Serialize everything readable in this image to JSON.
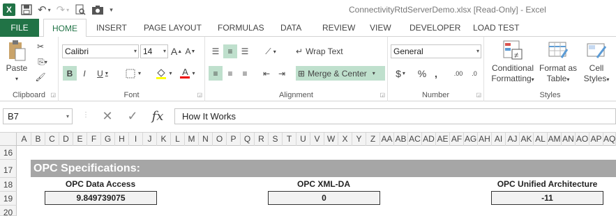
{
  "window": {
    "title": "ConnectivityRtdServerDemo.xlsx  [Read-Only] - Excel",
    "app_logo": "X"
  },
  "tabs": [
    "FILE",
    "HOME",
    "INSERT",
    "PAGE LAYOUT",
    "FORMULAS",
    "DATA",
    "REVIEW",
    "VIEW",
    "DEVELOPER",
    "LOAD TEST"
  ],
  "ribbon": {
    "clipboard": {
      "label": "Clipboard",
      "paste": "Paste"
    },
    "font": {
      "label": "Font",
      "name": "Calibri",
      "size": "14",
      "bold": "B",
      "italic": "I",
      "underline": "U",
      "grow": "A",
      "shrink": "A",
      "font_color": "A"
    },
    "alignment": {
      "label": "Alignment",
      "wrap_text": "Wrap Text",
      "merge_center": "Merge & Center"
    },
    "number": {
      "label": "Number",
      "format": "General",
      "currency": "$",
      "percent": "%",
      "comma": ",",
      "inc_decimal": ".00",
      "dec_decimal": ".0"
    },
    "styles": {
      "label": "Styles",
      "conditional": "Conditional",
      "conditional2": "Formatting",
      "format_table": "Format as",
      "format_table2": "Table",
      "cell_styles": "Cell",
      "cell_styles2": "Styles"
    }
  },
  "formula_bar": {
    "name_box": "B7",
    "fx": "fx",
    "value": "How It Works"
  },
  "columns": [
    "A",
    "B",
    "C",
    "D",
    "E",
    "F",
    "G",
    "H",
    "I",
    "J",
    "K",
    "L",
    "M",
    "N",
    "O",
    "P",
    "Q",
    "R",
    "S",
    "T",
    "U",
    "V",
    "W",
    "X",
    "Y",
    "Z",
    "AA",
    "AB",
    "AC",
    "AD",
    "AE",
    "AF",
    "AG",
    "AH",
    "AI",
    "AJ",
    "AK",
    "AL",
    "AM",
    "AN",
    "AO",
    "AP",
    "AQ"
  ],
  "rows": [
    "16",
    "17",
    "18",
    "19",
    "20"
  ],
  "sheet": {
    "banner": "OPC Specifications:",
    "items": [
      {
        "label": "OPC Data Access",
        "value": "9.849739075"
      },
      {
        "label": "OPC XML-DA",
        "value": "0"
      },
      {
        "label": "OPC Unified Architecture",
        "value": "-11"
      }
    ]
  },
  "colors": {
    "accent": "#217346",
    "banner": "#a6a6a6",
    "selected": "#bfe0cd"
  }
}
